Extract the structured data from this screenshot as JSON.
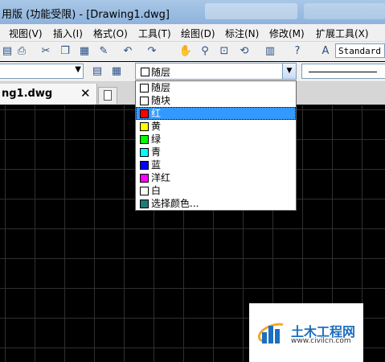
{
  "window": {
    "title": "用版 (功能受限) - [Drawing1.dwg]"
  },
  "menu": {
    "items": [
      "视图(V)",
      "插入(I)",
      "格式(O)",
      "工具(T)",
      "绘图(D)",
      "标注(N)",
      "修改(M)",
      "扩展工具(X)"
    ]
  },
  "toolbar": {
    "text_style": "Standard"
  },
  "properties": {
    "color_selected": "随层",
    "color_options": [
      {
        "label": "随层",
        "swatch": "#ffffff"
      },
      {
        "label": "随块",
        "swatch": "#ffffff"
      },
      {
        "label": "红",
        "swatch": "#ff0000",
        "selected": true
      },
      {
        "label": "黄",
        "swatch": "#ffff00"
      },
      {
        "label": "绿",
        "swatch": "#00ff00"
      },
      {
        "label": "青",
        "swatch": "#00ffff"
      },
      {
        "label": "蓝",
        "swatch": "#0000ff"
      },
      {
        "label": "洋红",
        "swatch": "#ff00ff"
      },
      {
        "label": "白",
        "swatch": "#ffffff"
      },
      {
        "label": "选择颜色...",
        "swatch": "#1e7b7b"
      }
    ]
  },
  "tabs": {
    "active": "ng1.dwg"
  },
  "watermark": {
    "name": "土木工程网",
    "url": "www.civilcn.com"
  }
}
